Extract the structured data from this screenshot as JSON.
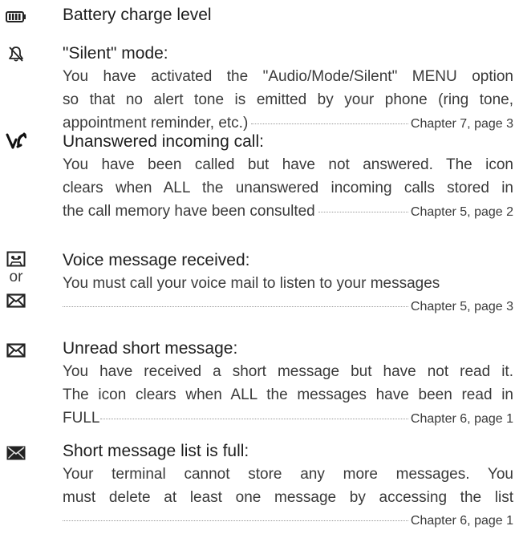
{
  "entries": [
    {
      "icon": "battery-icon",
      "title": "Battery charge level"
    },
    {
      "icon": "bell-crossed-icon",
      "title": "\"Silent\" mode:",
      "lines": [
        "You have activated the \"Audio/Mode/Silent\" MENU option",
        "so that no alert tone is emitted by your phone (ring tone,"
      ],
      "ref_lead": "appointment reminder, etc.)",
      "ref": "Chapter 7, page 3"
    },
    {
      "icon": "missed-call-icon",
      "title": "Unanswered incoming call:",
      "lines": [
        "You have been called but have not answered. The icon",
        "clears when ALL the unanswered incoming calls stored in"
      ],
      "ref_lead": "the call memory have been consulted",
      "ref": "Chapter 5, page 2"
    },
    {
      "icon": "voicemail-cassette-icon",
      "or_label": "or",
      "icon_alt": "envelope-outline-icon",
      "title": "Voice message received:",
      "lines": [
        "You must call your voice mail to listen to your messages"
      ],
      "ref_lead": "",
      "ref": "Chapter 5, page 3"
    },
    {
      "icon": "envelope-outline-icon",
      "title": "Unread short message:",
      "lines": [
        "You have received a short message but have not read it.",
        "The icon clears when ALL the messages have been read in"
      ],
      "ref_lead": "FULL",
      "ref": "Chapter 6, page 1"
    },
    {
      "icon": "envelope-full-icon",
      "title": "Short message list is full:",
      "lines": [
        "Your terminal cannot store any more messages. You",
        "must delete at least one message by accessing the list"
      ],
      "ref_lead": "",
      "ref": "Chapter 6, page 1"
    }
  ]
}
